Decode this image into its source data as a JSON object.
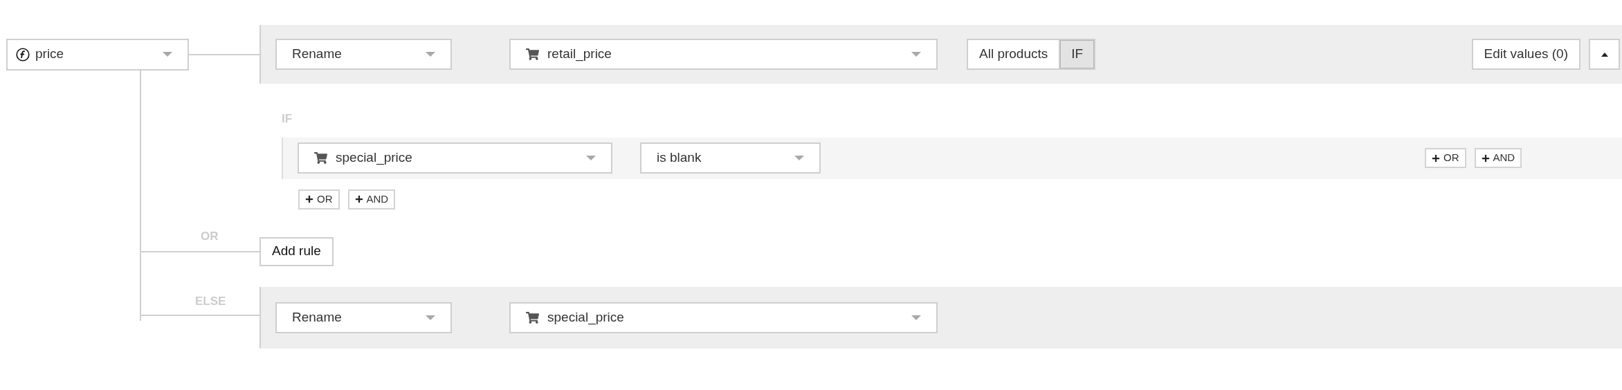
{
  "source_field": {
    "value": "price"
  },
  "main_rule": {
    "action": "Rename",
    "target": "retail_price",
    "scope": [
      {
        "label": "All products",
        "selected": false
      },
      {
        "label": "IF",
        "selected": true
      }
    ],
    "edit_values": "Edit values (0)"
  },
  "condition": {
    "label": "IF",
    "field": "special_price",
    "operator": "is blank",
    "row_buttons": [
      "OR",
      "AND"
    ],
    "group_buttons": [
      "OR",
      "AND"
    ]
  },
  "or_branch": {
    "label": "OR",
    "button": "Add rule"
  },
  "else_branch": {
    "label": "ELSE",
    "action": "Rename",
    "target": "special_price"
  }
}
